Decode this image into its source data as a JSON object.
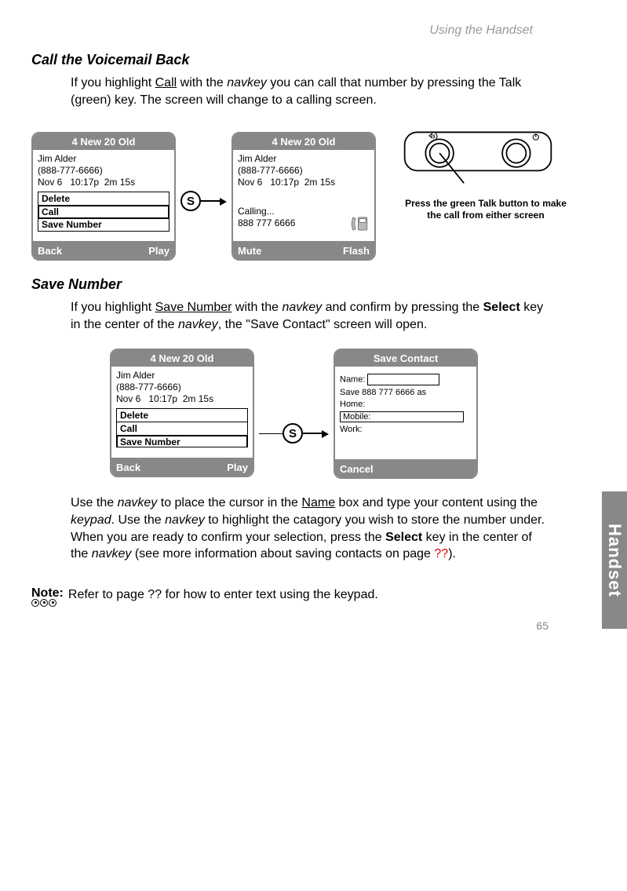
{
  "running_head": "Using the Handset",
  "side_tab": "Handset",
  "page_number": "65",
  "section1": {
    "title": "Call the Voicemail Back",
    "para_pre": "If you highlight ",
    "underlined": "Call",
    "para_mid1": " with the ",
    "italic1": "navkey",
    "para_tail": " you can call that number by pressing the Talk (green) key. The screen will change to a calling screen."
  },
  "screenA": {
    "title": "4 New 20 Old",
    "name": "Jim Alder",
    "number": "(888-777-6666)",
    "date": "Nov 6",
    "time": "10:17p",
    "dur": "2m 15s",
    "menu": {
      "item1": "Delete",
      "item2": "Call",
      "item3": "Save Number"
    },
    "soft_l": "Back",
    "soft_r": "Play"
  },
  "connector": {
    "label": "S"
  },
  "screenB": {
    "title": "4 New 20 Old",
    "name": "Jim Alder",
    "number": "(888-777-6666)",
    "date": "Nov 6",
    "time": "10:17p",
    "dur": "2m 15s",
    "calling": "Calling...",
    "dialed": "888 777 6666",
    "soft_l": "Mute",
    "soft_r": "Flash"
  },
  "handset_caption": "Press the green Talk button to make the call from either screen",
  "section2": {
    "title": "Save Number",
    "p1": "If you highlight ",
    "u1": "Save Number",
    "p2": " with the ",
    "i1": "navkey",
    "p3": " and confirm by pressing the ",
    "b1": "Select",
    "p4": " key in the center of the ",
    "i2": "navkey",
    "p5": ", the \"Save Contact\" screen will open."
  },
  "screenC": {
    "title": "4 New 20 Old",
    "name": "Jim Alder",
    "number": "(888-777-6666)",
    "date": "Nov 6",
    "time": "10:17p",
    "dur": "2m 15s",
    "menu": {
      "item1": "Delete",
      "item2": "Call",
      "item3": "Save Number"
    },
    "soft_l": "Back",
    "soft_r": "Play"
  },
  "screenD": {
    "title": "Save Contact",
    "name_lbl": "Name:",
    "save_as": "Save 888 777 6666 as",
    "home": "Home:",
    "mobile": "Mobile:",
    "work": "Work:",
    "soft_l": "Cancel"
  },
  "para3": {
    "t1": "Use the ",
    "i1": "navkey",
    "t2": " to place the cursor in the ",
    "u1": "Name",
    "t3": " box and type your content using the ",
    "i2": "keypad",
    "t4": ". Use the ",
    "i3": "navkey",
    "t5": " to highlight the catagory you wish to store the number under. When you are ready to confirm your selection, press the ",
    "b1": "Select",
    "t6": " key in the center of the ",
    "i4": "navkey",
    "t7": " (see more information about saving contacts on page ",
    "miss": "??",
    "t8": ")."
  },
  "note": {
    "label": "Note:",
    "t1": "Refer to page ",
    "miss": "??",
    "t2": " for how to enter text using the keypad."
  }
}
